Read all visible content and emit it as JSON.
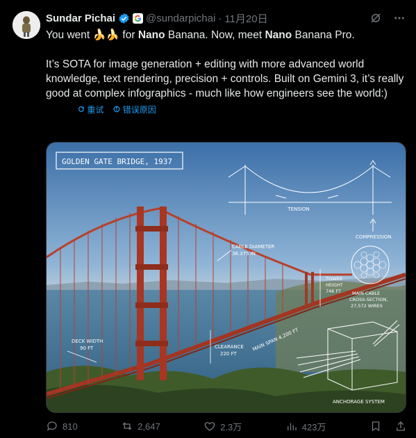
{
  "author": {
    "name": "Sundar Pichai",
    "handle": "@sundarpichai",
    "separator": "·",
    "date": "11月20日"
  },
  "tweet": {
    "line1_prefix": "You went ",
    "line1_emoji": "🍌🍌",
    "line1_for": " for ",
    "line1_nano1": "Nano",
    "line1_mid": " Banana. Now, meet ",
    "line1_nano2": "Nano",
    "line1_suffix": " Banana Pro.",
    "paragraph2": "It’s SOTA for image generation + editing with more advanced world knowledge, text rendering, precision + controls. Built on Gemini 3, it’s really good at complex infographics - much like how engineers see the world:)"
  },
  "translation": {
    "retry_label": "重试",
    "retry_icon": "refresh-icon",
    "error_label": "错误原因",
    "error_icon": "info-icon"
  },
  "media": {
    "title_box": "GOLDEN GATE BRIDGE, 1937",
    "tension": "TENSION",
    "compression": "COMPRESSION",
    "cable_diameter": "CABLE DIAMETER",
    "cable_diameter_value": "36.375 IN",
    "tower_height": "TOWER",
    "tower_height2": "HEIGHT",
    "tower_height_value": "746 FT",
    "main_cable": "MAIN CABLE",
    "cross_section": "CROSS-SECTION,",
    "wires": "27,572 WIRES",
    "deck_width": "DECK WIDTH",
    "deck_width_value": "90 FT",
    "clearance": "CLEARANCE",
    "clearance_value": "220 FT",
    "main_span": "MAIN SPAN 4,200 FT",
    "anchorage": "ANCHORAGE SYSTEM"
  },
  "actions": {
    "replies": "810",
    "reposts": "2,647",
    "likes": "2.3万",
    "views": "423万"
  },
  "colors": {
    "accent": "#1d9bf0",
    "muted": "#71767b",
    "bridge": "#b23a26",
    "sketch": "#ffffff"
  }
}
